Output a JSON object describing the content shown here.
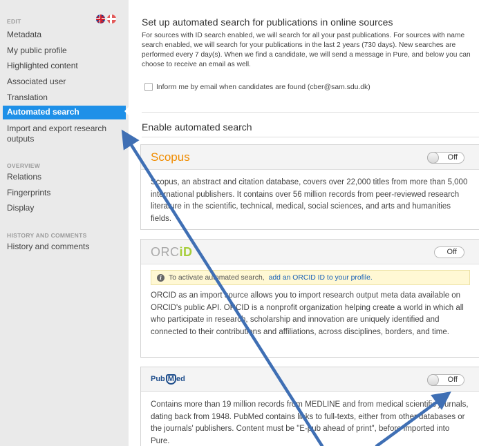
{
  "sidebar": {
    "section_edit": "EDIT",
    "section_overview": "OVERVIEW",
    "section_history": "HISTORY AND COMMENTS",
    "edit_items": [
      "Metadata",
      "My public profile",
      "Highlighted content",
      "Associated user",
      "Translation"
    ],
    "active_item": "Automated search",
    "import_export": "Import and export research outputs",
    "overview_items": [
      "Relations",
      "Fingerprints",
      "Display"
    ],
    "history_items": [
      "History and comments"
    ],
    "language_flags": [
      "uk-flag-icon",
      "denmark-flag-icon"
    ]
  },
  "main": {
    "setup_title": "Set up automated search for publications in online sources",
    "intro_text": "For sources with ID search enabled, we will search for all your past publications. For sources with name search enabled, we will search for your publications in the last 2 years (730 days). New searches are performed every 7 day(s). When we find a candidate, we will send a message in Pure, and below you can choose to receive an email as well.",
    "email_checkbox_label": "Inform me by email when candidates are found (cber@sam.sdu.dk)",
    "enable_title": "Enable automated search"
  },
  "sources": {
    "scopus": {
      "name": "Scopus",
      "toggle": "Off",
      "description": "Scopus, an abstract and citation database, covers over 22,000 titles from more than 5,000 international publishers. It contains over 56 million records from peer-reviewed research literature in the scientific, technical, medical, social sciences, and arts and humanities fields."
    },
    "orcid": {
      "name_prefix": "ORC",
      "name_id": "iD",
      "toggle": "Off",
      "notice_text": "To activate automated search,",
      "notice_link": "add an ORCID ID to your profile.",
      "description": "ORCID as an import source allows you to import research output meta data available on ORCID's public API. ORCID is a nonprofit organization helping create a world in which all who participate in research, scholarship and innovation are uniquely identified and connected to their contributions and affiliations, across disciplines, borders, and time."
    },
    "pubmed": {
      "name_prefix": "Pub",
      "name_m": "M",
      "name_suffix": "ed",
      "toggle": "Off",
      "description": "Contains more than 19 million records from MEDLINE and from medical scientific journals, dating back from 1948. PubMed contains links to full-texts, either from other databases or the journals' publishers. Content must be \"E-pub ahead of print\", before imported into Pure."
    }
  },
  "colors": {
    "active": "#1e90e8",
    "annotation_arrow": "#3f6fb4",
    "scopus": "#f08c00",
    "orcid_id": "#a6ce39"
  }
}
